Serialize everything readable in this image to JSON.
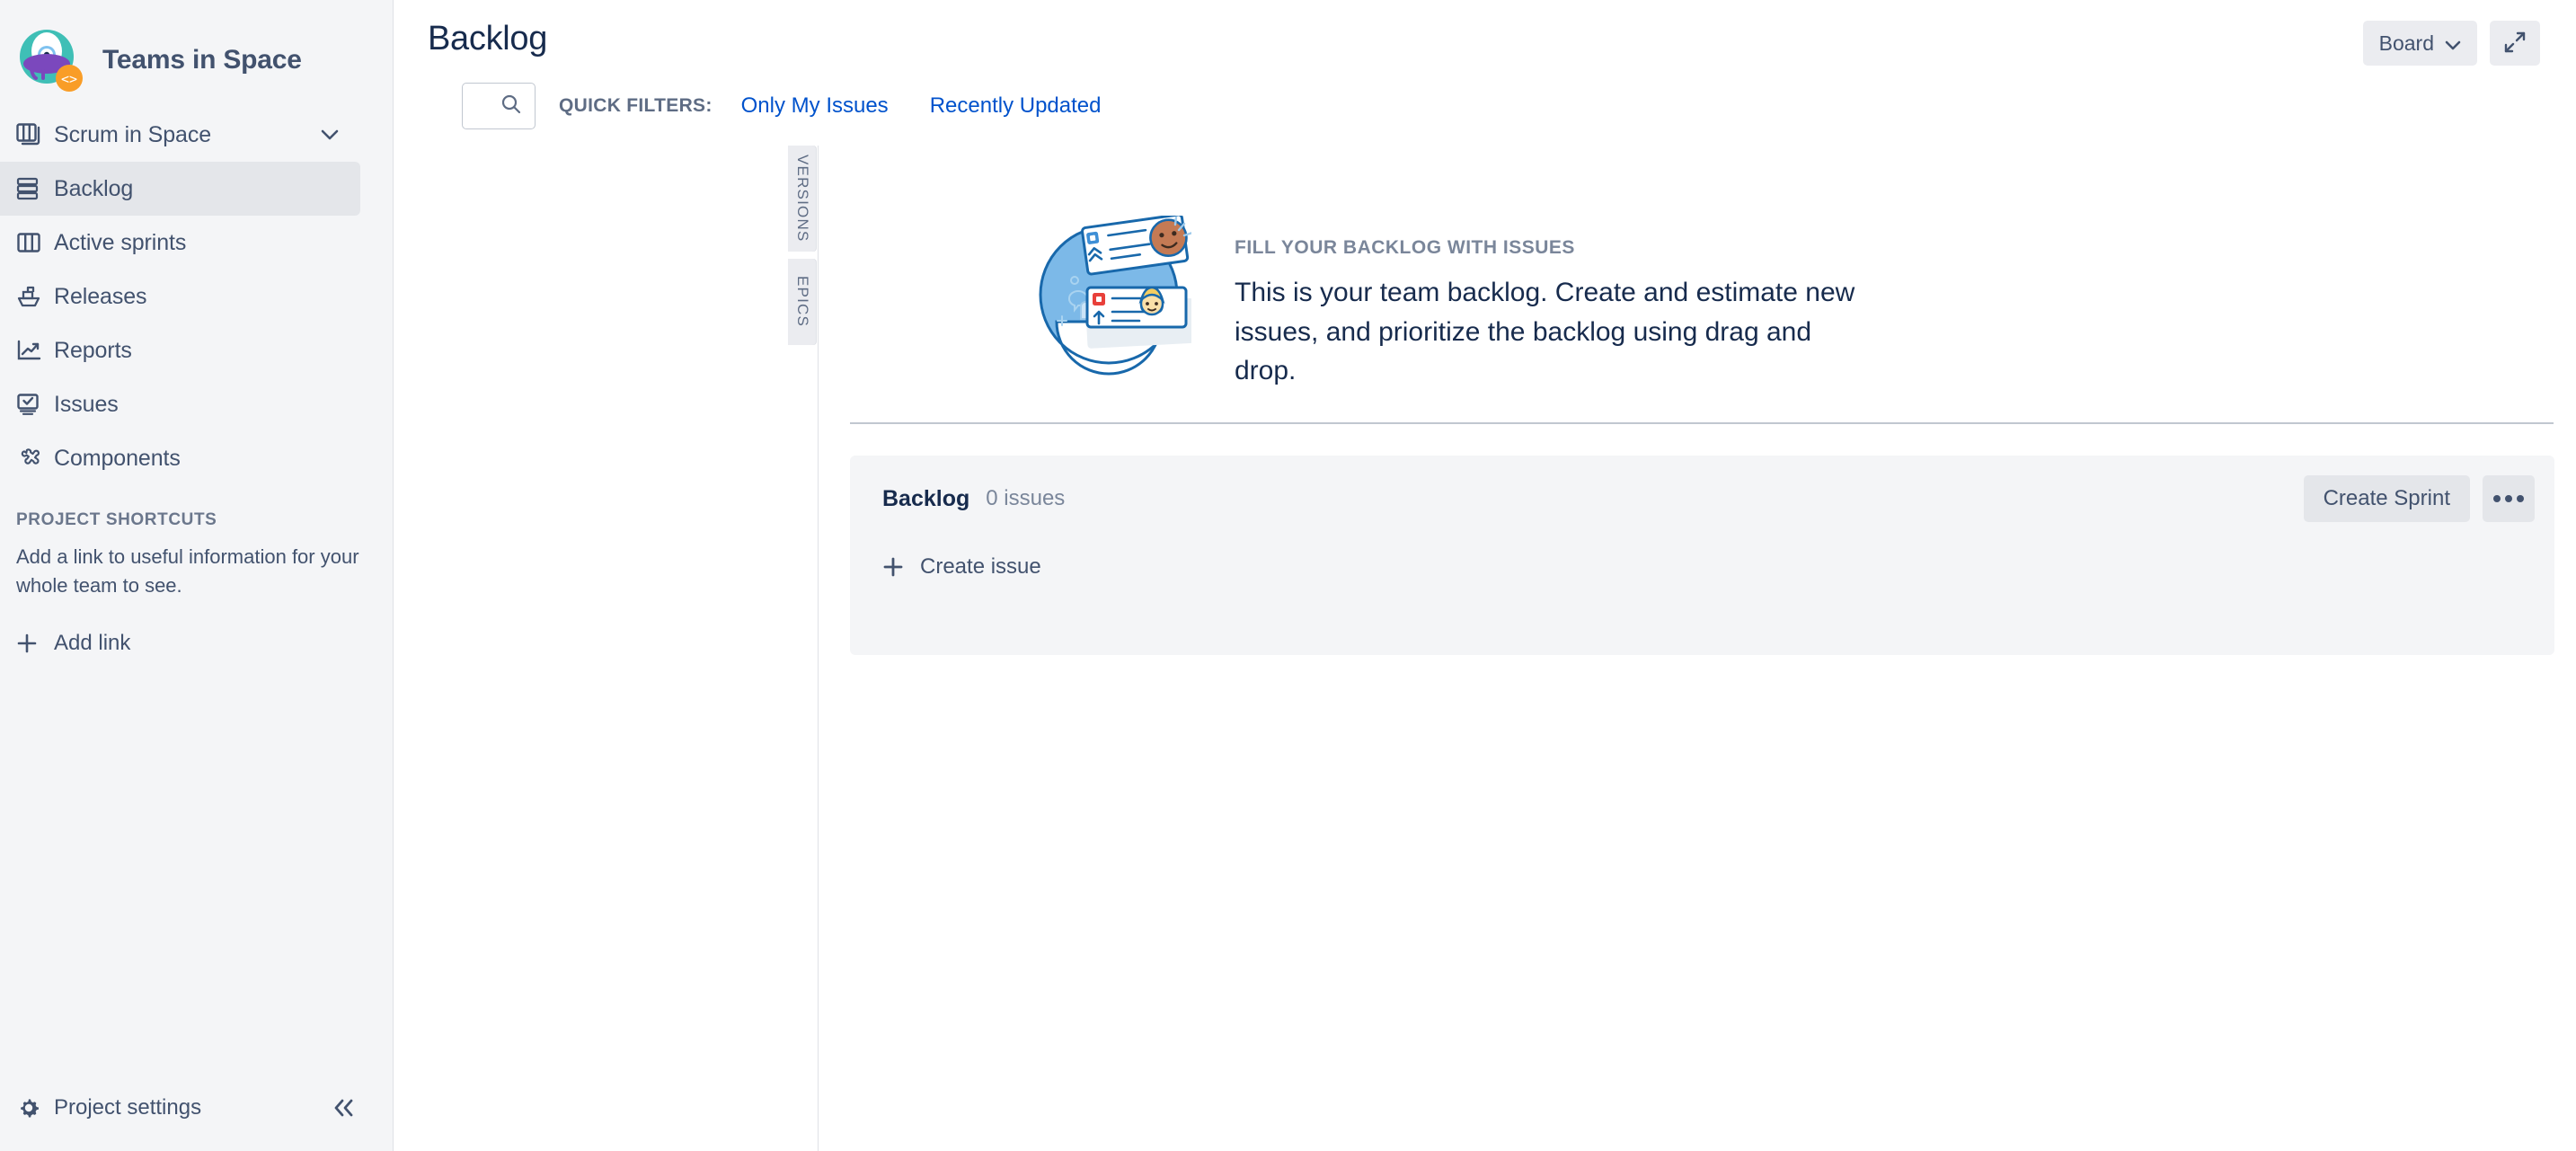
{
  "app": {
    "name": "Teams in Space",
    "logo_icon": "rocket-planet-logo",
    "logo_badge_icon": "code-badge-icon",
    "colors": {
      "sidebar_bg": "#f4f5f7",
      "accent_link": "#0052cc",
      "text_primary": "#172b4d",
      "text_secondary": "#42526e",
      "text_muted": "#7a869a",
      "active_item_bg": "#e4e6ea",
      "panel_bg": "#f4f5f7",
      "border": "#dfe1e6",
      "logo_teal": "#36b4ad",
      "logo_purple": "#7d4bbd",
      "logo_blue": "#6cb5ee",
      "logo_orange": "#f99d27"
    }
  },
  "sidebar": {
    "project_switcher": {
      "label": "Scrum in Space",
      "icon": "board-stack-icon",
      "chevron_icon": "chevron-down-icon"
    },
    "items": [
      {
        "label": "Backlog",
        "icon": "backlog-icon",
        "active": true
      },
      {
        "label": "Active sprints",
        "icon": "columns-board-icon",
        "active": false
      },
      {
        "label": "Releases",
        "icon": "ship-icon",
        "active": false
      },
      {
        "label": "Reports",
        "icon": "chart-trend-icon",
        "active": false
      },
      {
        "label": "Issues",
        "icon": "issues-screen-icon",
        "active": false
      },
      {
        "label": "Components",
        "icon": "puzzle-piece-icon",
        "active": false
      }
    ],
    "shortcuts": {
      "title": "PROJECT SHORTCUTS",
      "description": "Add a link to useful information for your whole team to see.",
      "add_link_label": "Add link",
      "add_link_icon": "plus-icon"
    },
    "footer": {
      "settings_label": "Project settings",
      "settings_icon": "gear-icon",
      "collapse_icon": "chevrons-left-icon"
    }
  },
  "header": {
    "title": "Backlog",
    "board_button": {
      "label": "Board",
      "icon": "chevron-down-icon"
    },
    "fullscreen_button": {
      "icon": "expand-arrows-icon"
    }
  },
  "filters": {
    "search_placeholder": "",
    "search_value": "",
    "search_icon": "search-icon",
    "quick_filters_label": "QUICK FILTERS:",
    "links": [
      {
        "label": "Only My Issues"
      },
      {
        "label": "Recently Updated"
      }
    ]
  },
  "side_tabs": [
    {
      "label": "VERSIONS"
    },
    {
      "label": "EPICS"
    }
  ],
  "empty_state": {
    "illustration_icon": "backlog-cards-illustration",
    "kicker": "FILL YOUR BACKLOG WITH ISSUES",
    "body": "This is your team backlog. Create and estimate new issues, and prioritize the backlog using drag and drop."
  },
  "backlog_panel": {
    "name": "Backlog",
    "issue_count": "0 issues",
    "create_sprint_label": "Create Sprint",
    "more_menu_icon": "ellipsis-icon",
    "create_issue_label": "Create issue",
    "create_issue_icon": "plus-icon"
  }
}
